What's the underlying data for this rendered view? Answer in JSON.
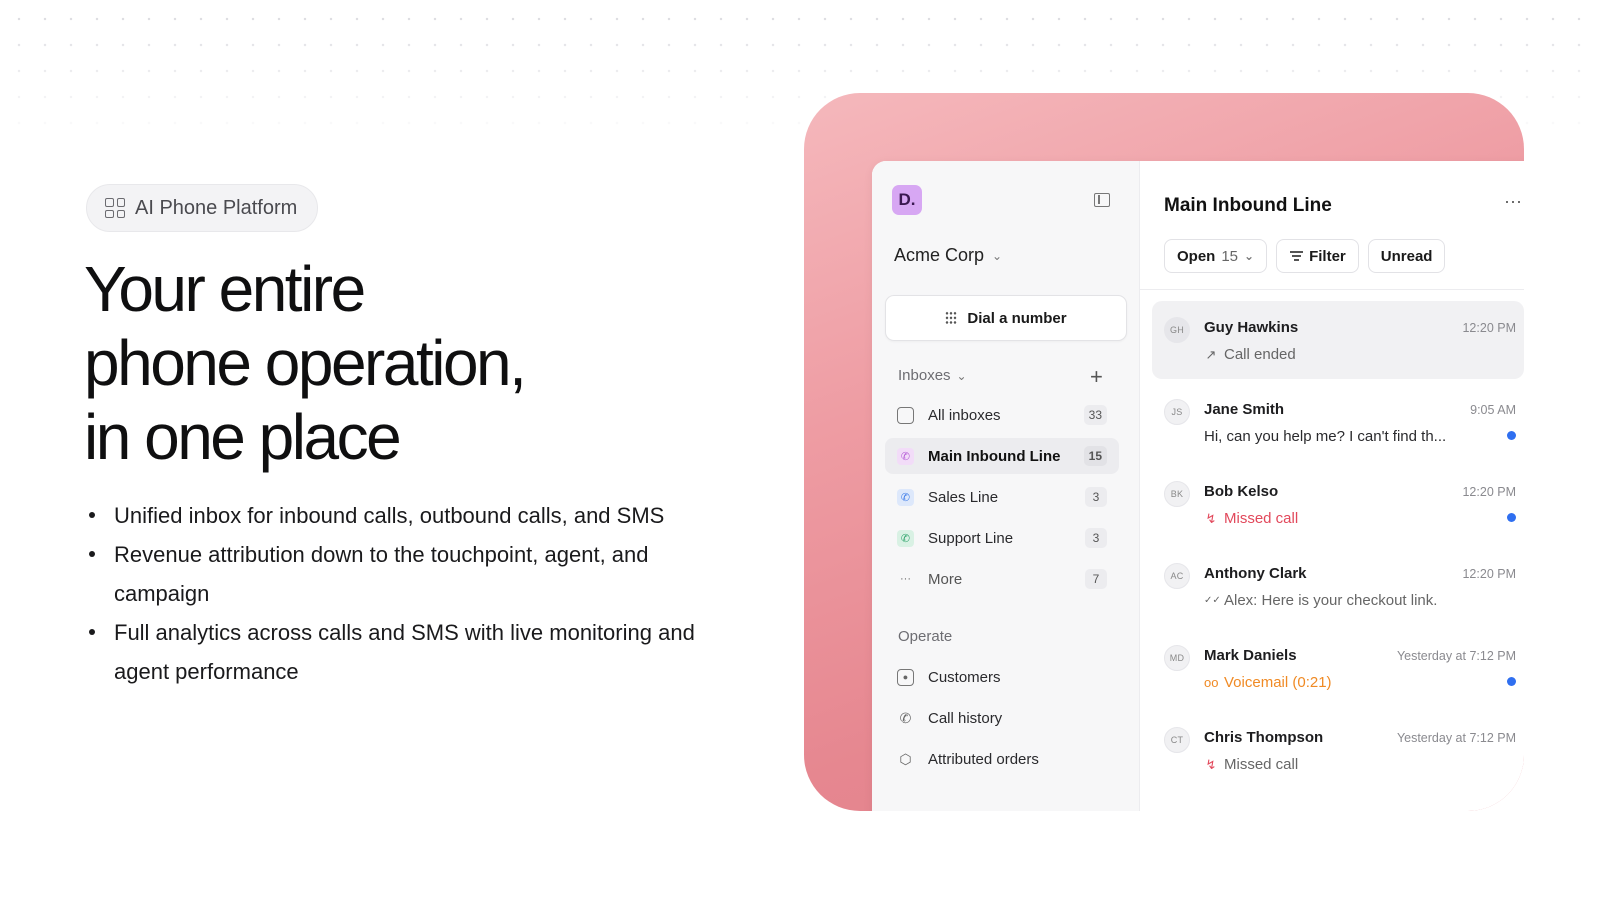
{
  "hero": {
    "badge_label": "AI Phone Platform",
    "badge_icon": "grid-icon",
    "headline_lines": [
      "Your entire",
      "phone operation,",
      "in one place"
    ],
    "bullets": [
      "Unified inbox for inbound calls, outbound calls, and SMS",
      "Revenue attribution down to the touchpoint, agent, and campaign",
      "Full analytics across calls and SMS with live monitoring and agent performance"
    ]
  },
  "app": {
    "logo_text": "D.",
    "org_name": "Acme Corp",
    "dial_label": "Dial a number",
    "inboxes_label": "Inboxes",
    "nav": [
      {
        "label": "All inboxes",
        "count": "33",
        "icon": "inbox-icon",
        "icon_color": "#666666"
      },
      {
        "label": "Main Inbound Line",
        "count": "15",
        "icon": "phone-icon",
        "icon_color": "#b45bd6",
        "active": true
      },
      {
        "label": "Sales Line",
        "count": "3",
        "icon": "phone-icon",
        "icon_color": "#3d7be8"
      },
      {
        "label": "Support Line",
        "count": "3",
        "icon": "phone-icon",
        "icon_color": "#2fa36b"
      },
      {
        "label": "More",
        "count": "7",
        "icon": "more-icon",
        "icon_color": "#666666"
      }
    ],
    "operate_label": "Operate",
    "operate": [
      {
        "label": "Customers",
        "icon": "contact-icon"
      },
      {
        "label": "Call history",
        "icon": "phone-history-icon"
      },
      {
        "label": "Attributed orders",
        "icon": "package-icon"
      }
    ],
    "main_title": "Main Inbound Line",
    "toolbar": {
      "open_label": "Open",
      "open_count": "15",
      "filter_label": "Filter",
      "unread_label": "Unread"
    },
    "conversations": [
      {
        "initials": "GH",
        "name": "Guy Hawkins",
        "time": "12:20 PM",
        "sub": "Call ended",
        "sub_icon": "↗",
        "tone": "muted",
        "unread": false,
        "active": true
      },
      {
        "initials": "JS",
        "name": "Jane Smith",
        "time": "9:05 AM",
        "sub": "Hi, can you help me? I can't find th...",
        "sub_icon": "",
        "tone": "dark",
        "unread": true
      },
      {
        "initials": "BK",
        "name": "Bob Kelso",
        "time": "12:20 PM",
        "sub": "Missed call",
        "sub_icon": "↯",
        "tone": "red",
        "unread": true
      },
      {
        "initials": "AC",
        "name": "Anthony Clark",
        "time": "12:20 PM",
        "sub": "Alex: Here is your checkout link.",
        "sub_icon": "✓✓",
        "tone": "muted",
        "unread": false
      },
      {
        "initials": "MD",
        "name": "Mark Daniels",
        "time": "Yesterday at 7:12 PM",
        "sub": "Voicemail (0:21)",
        "sub_icon": "oo",
        "tone": "orange",
        "unread": true
      },
      {
        "initials": "CT",
        "name": "Chris Thompson",
        "time": "Yesterday at 7:12 PM",
        "sub": "Missed call",
        "sub_icon": "↯",
        "tone": "muted-red",
        "unread": false
      }
    ]
  },
  "colors": {
    "frame_gradient_start": "#f5b8bc",
    "frame_gradient_end": "#e07f8a",
    "unread_dot": "#2f6ff0",
    "missed": "#e2485b",
    "voicemail": "#f08a24",
    "logo_bg": "#d7a7f3"
  }
}
